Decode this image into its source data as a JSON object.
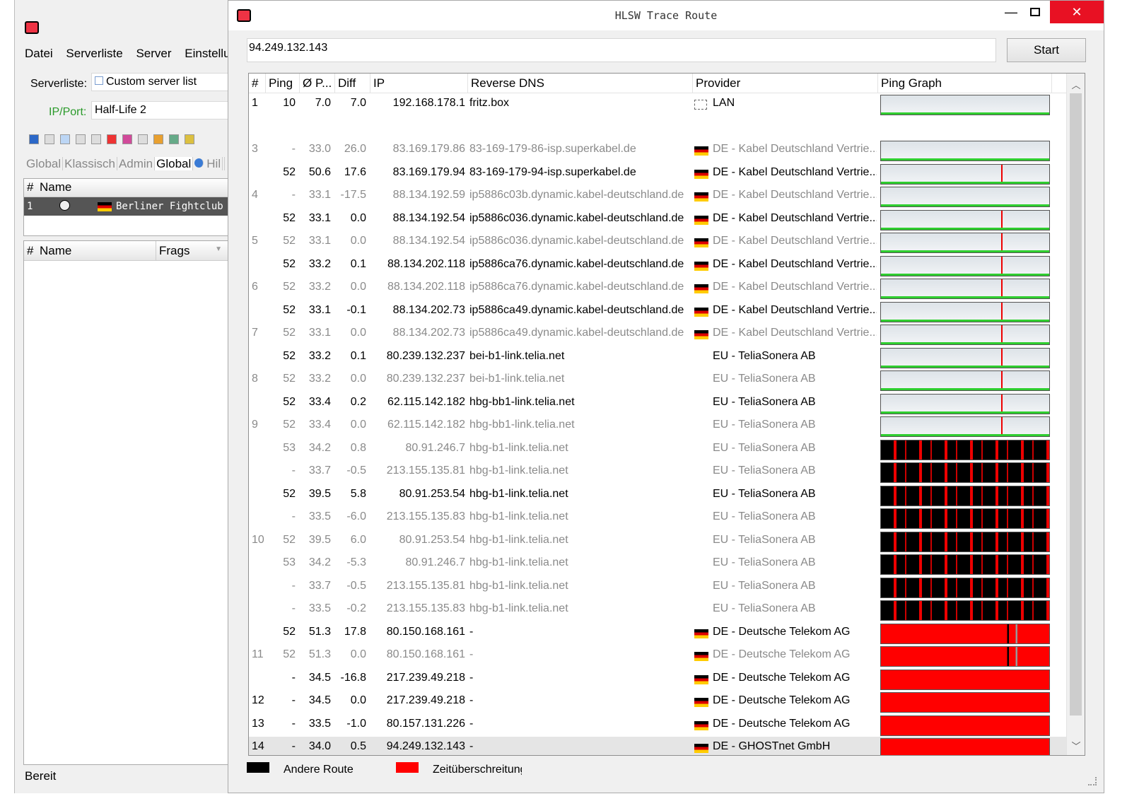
{
  "bg_window": {
    "menu": [
      "Datei",
      "Serverliste",
      "Server",
      "Einstellu"
    ],
    "serverliste_label": "Serverliste:",
    "serverliste_value": "Custom server list",
    "ipport_label": "IP/Port:",
    "ipport_value": "Half-Life 2",
    "tabs": [
      "Global",
      "Klassisch",
      "Admin",
      "Global",
      "Hil"
    ],
    "list1_head": {
      "num": "#",
      "name": "Name"
    },
    "list1_row": {
      "num": "1",
      "name": "Berliner Fightclub [NoS"
    },
    "list2_head": {
      "num": "#",
      "name": "Name",
      "frags": "Frags"
    },
    "status": "Bereit"
  },
  "dialog": {
    "title": "HLSW Trace Route",
    "ip_value": "94.249.132.143",
    "start_label": "Start",
    "columns": [
      "#",
      "Ping",
      "Ø P...",
      "Diff",
      "IP",
      "Reverse DNS",
      "Provider",
      "Ping Graph"
    ],
    "rows": [
      {
        "n": "1",
        "ping": "10",
        "avg": "7.0",
        "diff": "7.0",
        "ip": "192.168.178.1",
        "dns": "fritz.box",
        "prov": "LAN",
        "flag": "lan",
        "gray": false,
        "graph": "ok"
      },
      {
        "n": "",
        "ping": "",
        "avg": "",
        "diff": "",
        "ip": "",
        "dns": "",
        "prov": "",
        "flag": "",
        "gray": false,
        "graph": ""
      },
      {
        "n": "3",
        "ping": "-",
        "avg": "33.0",
        "diff": "26.0",
        "ip": "83.169.179.86",
        "dns": "83-169-179-86-isp.superkabel.de",
        "prov": "DE - Kabel Deutschland Vertrie...",
        "flag": "de",
        "gray": true,
        "graph": "ok"
      },
      {
        "n": "",
        "ping": "52",
        "avg": "50.6",
        "diff": "17.6",
        "ip": "83.169.179.94",
        "dns": "83-169-179-94-isp.superkabel.de",
        "prov": "DE - Kabel Deutschland Vertrie...",
        "flag": "de",
        "gray": false,
        "graph": "okred"
      },
      {
        "n": "4",
        "ping": "-",
        "avg": "33.1",
        "diff": "-17.5",
        "ip": "88.134.192.59",
        "dns": "ip5886c03b.dynamic.kabel-deutschland.de",
        "prov": "DE - Kabel Deutschland Vertrie...",
        "flag": "de",
        "gray": true,
        "graph": "ok"
      },
      {
        "n": "",
        "ping": "52",
        "avg": "33.1",
        "diff": "0.0",
        "ip": "88.134.192.54",
        "dns": "ip5886c036.dynamic.kabel-deutschland.de",
        "prov": "DE - Kabel Deutschland Vertrie...",
        "flag": "de",
        "gray": false,
        "graph": "okred"
      },
      {
        "n": "5",
        "ping": "52",
        "avg": "33.1",
        "diff": "0.0",
        "ip": "88.134.192.54",
        "dns": "ip5886c036.dynamic.kabel-deutschland.de",
        "prov": "DE - Kabel Deutschland Vertrie...",
        "flag": "de",
        "gray": true,
        "graph": "okred"
      },
      {
        "n": "",
        "ping": "52",
        "avg": "33.2",
        "diff": "0.1",
        "ip": "88.134.202.118",
        "dns": "ip5886ca76.dynamic.kabel-deutschland.de",
        "prov": "DE - Kabel Deutschland Vertrie...",
        "flag": "de",
        "gray": false,
        "graph": "okred"
      },
      {
        "n": "6",
        "ping": "52",
        "avg": "33.2",
        "diff": "0.0",
        "ip": "88.134.202.118",
        "dns": "ip5886ca76.dynamic.kabel-deutschland.de",
        "prov": "DE - Kabel Deutschland Vertrie...",
        "flag": "de",
        "gray": true,
        "graph": "okred"
      },
      {
        "n": "",
        "ping": "52",
        "avg": "33.1",
        "diff": "-0.1",
        "ip": "88.134.202.73",
        "dns": "ip5886ca49.dynamic.kabel-deutschland.de",
        "prov": "DE - Kabel Deutschland Vertrie...",
        "flag": "de",
        "gray": false,
        "graph": "okred"
      },
      {
        "n": "7",
        "ping": "52",
        "avg": "33.1",
        "diff": "0.0",
        "ip": "88.134.202.73",
        "dns": "ip5886ca49.dynamic.kabel-deutschland.de",
        "prov": "DE - Kabel Deutschland Vertrie...",
        "flag": "de",
        "gray": true,
        "graph": "okred"
      },
      {
        "n": "",
        "ping": "52",
        "avg": "33.2",
        "diff": "0.1",
        "ip": "80.239.132.237",
        "dns": "bei-b1-link.telia.net",
        "prov": "EU - TeliaSonera AB",
        "flag": "",
        "gray": false,
        "graph": "okred"
      },
      {
        "n": "8",
        "ping": "52",
        "avg": "33.2",
        "diff": "0.0",
        "ip": "80.239.132.237",
        "dns": "bei-b1-link.telia.net",
        "prov": "EU - TeliaSonera AB",
        "flag": "",
        "gray": true,
        "graph": "okred"
      },
      {
        "n": "",
        "ping": "52",
        "avg": "33.4",
        "diff": "0.2",
        "ip": "62.115.142.182",
        "dns": "hbg-bb1-link.telia.net",
        "prov": "EU - TeliaSonera AB",
        "flag": "",
        "gray": false,
        "graph": "okred"
      },
      {
        "n": "9",
        "ping": "52",
        "avg": "33.4",
        "diff": "0.0",
        "ip": "62.115.142.182",
        "dns": "hbg-bb1-link.telia.net",
        "prov": "EU - TeliaSonera AB",
        "flag": "",
        "gray": true,
        "graph": "okred"
      },
      {
        "n": "",
        "ping": "53",
        "avg": "34.2",
        "diff": "0.8",
        "ip": "80.91.246.7",
        "dns": "hbg-b1-link.telia.net",
        "prov": "EU - TeliaSonera AB",
        "flag": "",
        "gray": true,
        "graph": "black"
      },
      {
        "n": "",
        "ping": "-",
        "avg": "33.7",
        "diff": "-0.5",
        "ip": "213.155.135.81",
        "dns": "hbg-b1-link.telia.net",
        "prov": "EU - TeliaSonera AB",
        "flag": "",
        "gray": true,
        "graph": "black"
      },
      {
        "n": "",
        "ping": "52",
        "avg": "39.5",
        "diff": "5.8",
        "ip": "80.91.253.54",
        "dns": "hbg-b1-link.telia.net",
        "prov": "EU - TeliaSonera AB",
        "flag": "",
        "gray": false,
        "graph": "black"
      },
      {
        "n": "",
        "ping": "-",
        "avg": "33.5",
        "diff": "-6.0",
        "ip": "213.155.135.83",
        "dns": "hbg-b1-link.telia.net",
        "prov": "EU - TeliaSonera AB",
        "flag": "",
        "gray": true,
        "graph": "black"
      },
      {
        "n": "10",
        "ping": "52",
        "avg": "39.5",
        "diff": "6.0",
        "ip": "80.91.253.54",
        "dns": "hbg-b1-link.telia.net",
        "prov": "EU - TeliaSonera AB",
        "flag": "",
        "gray": true,
        "graph": "black"
      },
      {
        "n": "",
        "ping": "53",
        "avg": "34.2",
        "diff": "-5.3",
        "ip": "80.91.246.7",
        "dns": "hbg-b1-link.telia.net",
        "prov": "EU - TeliaSonera AB",
        "flag": "",
        "gray": true,
        "graph": "black"
      },
      {
        "n": "",
        "ping": "-",
        "avg": "33.7",
        "diff": "-0.5",
        "ip": "213.155.135.81",
        "dns": "hbg-b1-link.telia.net",
        "prov": "EU - TeliaSonera AB",
        "flag": "",
        "gray": true,
        "graph": "black"
      },
      {
        "n": "",
        "ping": "-",
        "avg": "33.5",
        "diff": "-0.2",
        "ip": "213.155.135.83",
        "dns": "hbg-b1-link.telia.net",
        "prov": "EU - TeliaSonera AB",
        "flag": "",
        "gray": true,
        "graph": "black"
      },
      {
        "n": "",
        "ping": "52",
        "avg": "51.3",
        "diff": "17.8",
        "ip": "80.150.168.161",
        "dns": "-",
        "prov": "DE - Deutsche Telekom AG",
        "flag": "de",
        "gray": false,
        "graph": "red2"
      },
      {
        "n": "11",
        "ping": "52",
        "avg": "51.3",
        "diff": "0.0",
        "ip": "80.150.168.161",
        "dns": "-",
        "prov": "DE - Deutsche Telekom AG",
        "flag": "de",
        "gray": true,
        "graph": "red2"
      },
      {
        "n": "",
        "ping": "-",
        "avg": "34.5",
        "diff": "-16.8",
        "ip": "217.239.49.218",
        "dns": "-",
        "prov": "DE - Deutsche Telekom AG",
        "flag": "de",
        "gray": false,
        "graph": "red"
      },
      {
        "n": "12",
        "ping": "-",
        "avg": "34.5",
        "diff": "0.0",
        "ip": "217.239.49.218",
        "dns": "-",
        "prov": "DE - Deutsche Telekom AG",
        "flag": "de",
        "gray": false,
        "graph": "red"
      },
      {
        "n": "13",
        "ping": "-",
        "avg": "33.5",
        "diff": "-1.0",
        "ip": "80.157.131.226",
        "dns": "-",
        "prov": "DE - Deutsche Telekom AG",
        "flag": "de",
        "gray": false,
        "graph": "red"
      },
      {
        "n": "14",
        "ping": "-",
        "avg": "34.0",
        "diff": "0.5",
        "ip": "94.249.132.143",
        "dns": "-",
        "prov": "DE - GHOSTnet GmbH",
        "flag": "de",
        "gray": false,
        "graph": "red",
        "selected": true
      }
    ],
    "legend": [
      {
        "label": "Andere Route",
        "color": "#000000"
      },
      {
        "label": "Zeitüberschreitung",
        "color": "#ff0000"
      }
    ]
  }
}
